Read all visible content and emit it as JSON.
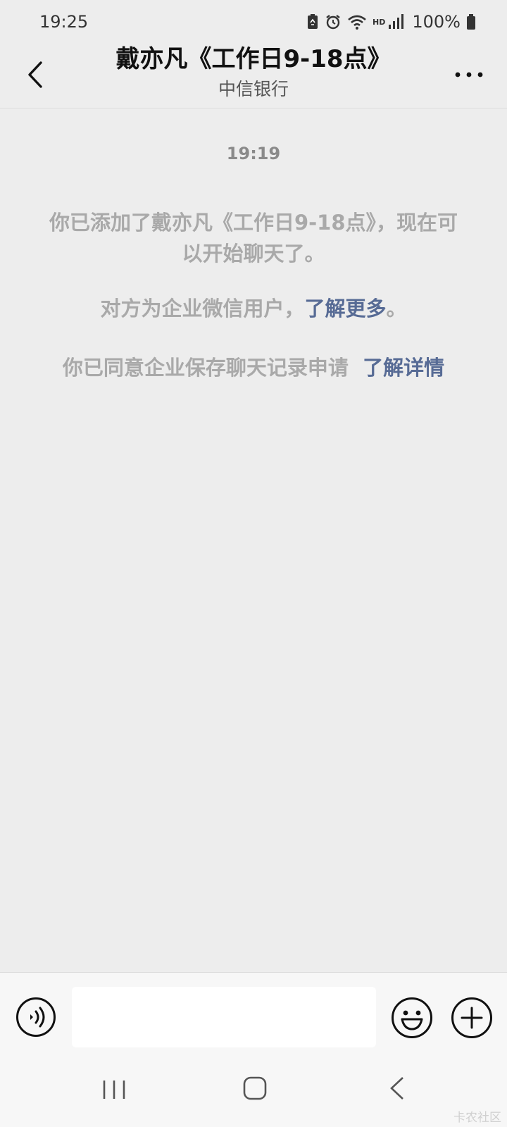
{
  "status_bar": {
    "time": "19:25",
    "hd_label": "HD",
    "battery": "100%",
    "icons": [
      "recycle-battery-icon",
      "alarm-icon",
      "wifi-icon",
      "signal-icon",
      "battery-icon"
    ]
  },
  "header": {
    "title": "戴亦凡《工作日9-18点》",
    "subtitle": "中信银行",
    "back_icon": "chevron-left-icon",
    "more_icon": "more-dots-icon"
  },
  "messages": {
    "timestamp": "19:19",
    "added_notice": "你已添加了戴亦凡《工作日9-18点》，现在可以开始聊天了。",
    "enterprise_text": "对方为企业微信用户，",
    "enterprise_link": "了解更多",
    "enterprise_end": "。",
    "consent_text": "你已同意企业保存聊天记录申请",
    "consent_link": "了解详情"
  },
  "input_bar": {
    "input_value": "",
    "voice_icon": "voice-icon",
    "emoji_icon": "emoji-icon",
    "plus_icon": "plus-icon"
  },
  "nav_bar": {
    "watermark": "卡农社区"
  },
  "colors": {
    "background": "#ededed",
    "link": "#576b95",
    "system_text": "#a9a9a9",
    "bar_background": "#f7f7f7"
  }
}
